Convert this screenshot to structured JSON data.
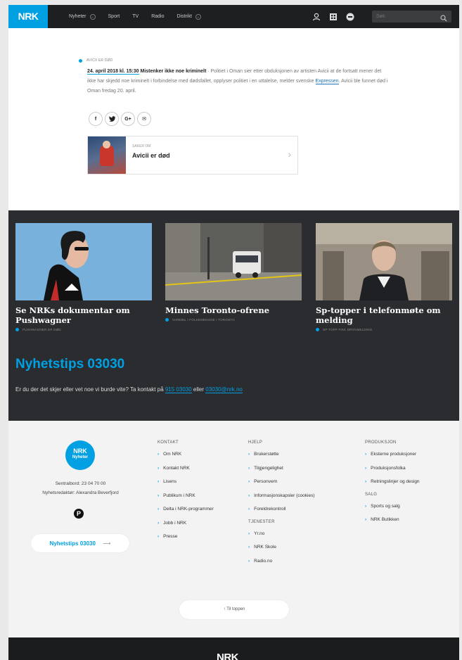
{
  "header": {
    "logo": "NRK",
    "nav": [
      {
        "label": "Nyheter",
        "has_dropdown": true
      },
      {
        "label": "Sport",
        "has_dropdown": false
      },
      {
        "label": "TV",
        "has_dropdown": false
      },
      {
        "label": "Radio",
        "has_dropdown": false
      },
      {
        "label": "Distrikt",
        "has_dropdown": true
      }
    ],
    "icons": [
      "user-icon",
      "grid-icon",
      "nrk-super-icon"
    ],
    "search_placeholder": "Søk"
  },
  "article": {
    "kicker": "AVICII ER DØD",
    "date": "24. april 2018 kl. 15:30",
    "headline": "Mistenker ikke noe kriminelt",
    "body_1": " · Politiet i Oman sier etter obduksjonen av artisten Avicii at de fortsatt mener det ikke har skjedd noe kriminelt i forbindelse med dødsfallet, opplyser politiet i en uttalelse, melder svenske ",
    "link": "Expressen",
    "body_2": ". Avicii ble funnet død i Oman fredag 20. april.",
    "share": [
      "f",
      "t",
      "G+",
      "✉"
    ]
  },
  "related": {
    "label": "SAKER OM",
    "title": "Avicii er død"
  },
  "cards": [
    {
      "title": "Se NRKs dokumentar om Pushwagner",
      "meta": "PUSHWAGNER ER DØD"
    },
    {
      "title": "Minnes Toronto-ofrene",
      "meta": "VAREBIL I FOLKEMENGDE I TORONTO"
    },
    {
      "title": "Sp-topper i telefonmøte om melding",
      "meta": "SP-TOPP FIKK DROVMELDING"
    }
  ],
  "tips": {
    "title": "Nyhetstips 03030",
    "text": "Er du der det skjer eller vet noe vi burde vite? Ta kontakt på ",
    "phone": "915 03030",
    "or": " eller ",
    "email": "03030@nrk.no"
  },
  "footer": {
    "logo_top": "NRK",
    "logo_bottom": "Nyheter",
    "switchboard": "Sentralbord: 23 04 70 00",
    "editor": "Nyhetsredaktør: Alexandra Beverfjord",
    "p_badge": "P",
    "tips_button": "Nyhetstips 03030",
    "tips_arrow": "⟶",
    "kontakt": {
      "head": "KONTAKT",
      "items": [
        "Om NRK",
        "Kontakt NRK",
        "Lisens",
        "Publikum i NRK",
        "Delta i NRK-programmer",
        "Jobb i NRK",
        "Presse"
      ]
    },
    "hjelp": {
      "head": "HJELP",
      "items": [
        "Brukerstøtte",
        "Tilgjengelighet",
        "Personvern",
        "Informasjonskapsler (cookies)",
        "Foreldrekontroll"
      ]
    },
    "tjenester": {
      "head": "TJENESTER",
      "items": [
        "Yr.no",
        "NRK Skole",
        "Radio.no"
      ]
    },
    "produksjon": {
      "head": "PRODUKSJON",
      "items": [
        "Eksterne produksjoner",
        "Produksjonsfolka",
        "Retningslinjer og design"
      ]
    },
    "salg": {
      "head": "SALG",
      "items": [
        "Sports og salg",
        "NRK Butikken"
      ]
    },
    "to_top": "Til toppen",
    "to_top_arrow": "↑",
    "bottom_logo": "NRK"
  },
  "colors": {
    "accent": "#00a0e3",
    "dark": "#2a2c2f",
    "topbar": "#1e1f21"
  }
}
